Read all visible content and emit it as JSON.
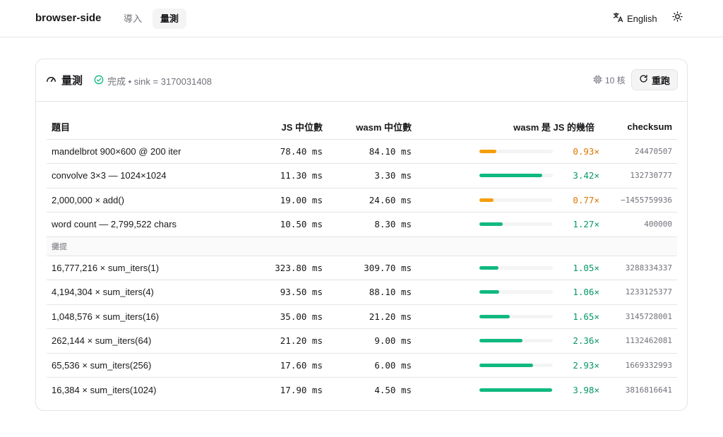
{
  "header": {
    "brand": "browser-side",
    "tabs": [
      {
        "label": "導入",
        "active": false
      },
      {
        "label": "量測",
        "active": true
      }
    ],
    "language": "English",
    "language_icon": "translate-icon",
    "theme_icon": "sun-icon"
  },
  "card": {
    "title": "量測",
    "title_icon": "gauge-icon",
    "status": "完成 • sink = 3170031408",
    "status_icon": "check-circle-icon",
    "cores": "10 核",
    "cores_icon": "cpu-icon",
    "rerun_label": "重跑",
    "rerun_icon": "refresh-icon"
  },
  "table": {
    "columns": [
      "題目",
      "JS 中位數",
      "wasm 中位數",
      "wasm 是 JS 的幾倍",
      "checksum"
    ],
    "rows": [
      {
        "name": "mandelbrot 900×600 @ 200 iter",
        "js": "78.40 ms",
        "wasm": "84.10 ms",
        "ratio": "0.93×",
        "ratio_value": 0.93,
        "checksum": "24470507"
      },
      {
        "name": "convolve 3×3 — 1024×1024",
        "js": "11.30 ms",
        "wasm": "3.30 ms",
        "ratio": "3.42×",
        "ratio_value": 3.42,
        "checksum": "132730777"
      },
      {
        "name": "2,000,000 × add()",
        "js": "19.00 ms",
        "wasm": "24.60 ms",
        "ratio": "0.77×",
        "ratio_value": 0.77,
        "checksum": "−1455759936"
      },
      {
        "name": "word count — 2,799,522 chars",
        "js": "10.50 ms",
        "wasm": "8.30 ms",
        "ratio": "1.27×",
        "ratio_value": 1.27,
        "checksum": "400000"
      }
    ],
    "section_label": "攤提",
    "section_rows": [
      {
        "name": "16,777,216 × sum_iters(1)",
        "js": "323.80 ms",
        "wasm": "309.70 ms",
        "ratio": "1.05×",
        "ratio_value": 1.05,
        "checksum": "3288334337"
      },
      {
        "name": "4,194,304 × sum_iters(4)",
        "js": "93.50 ms",
        "wasm": "88.10 ms",
        "ratio": "1.06×",
        "ratio_value": 1.06,
        "checksum": "1233125377"
      },
      {
        "name": "1,048,576 × sum_iters(16)",
        "js": "35.00 ms",
        "wasm": "21.20 ms",
        "ratio": "1.65×",
        "ratio_value": 1.65,
        "checksum": "3145728001"
      },
      {
        "name": "262,144 × sum_iters(64)",
        "js": "21.20 ms",
        "wasm": "9.00 ms",
        "ratio": "2.36×",
        "ratio_value": 2.36,
        "checksum": "1132462081"
      },
      {
        "name": "65,536 × sum_iters(256)",
        "js": "17.60 ms",
        "wasm": "6.00 ms",
        "ratio": "2.93×",
        "ratio_value": 2.93,
        "checksum": "1669332993"
      },
      {
        "name": "16,384 × sum_iters(1024)",
        "js": "17.90 ms",
        "wasm": "4.50 ms",
        "ratio": "3.98×",
        "ratio_value": 3.98,
        "checksum": "3816816641"
      }
    ]
  },
  "colors": {
    "faster": "#10b981",
    "slower": "#f59e0b",
    "faster_text": "#059669",
    "slower_text": "#d97706"
  }
}
